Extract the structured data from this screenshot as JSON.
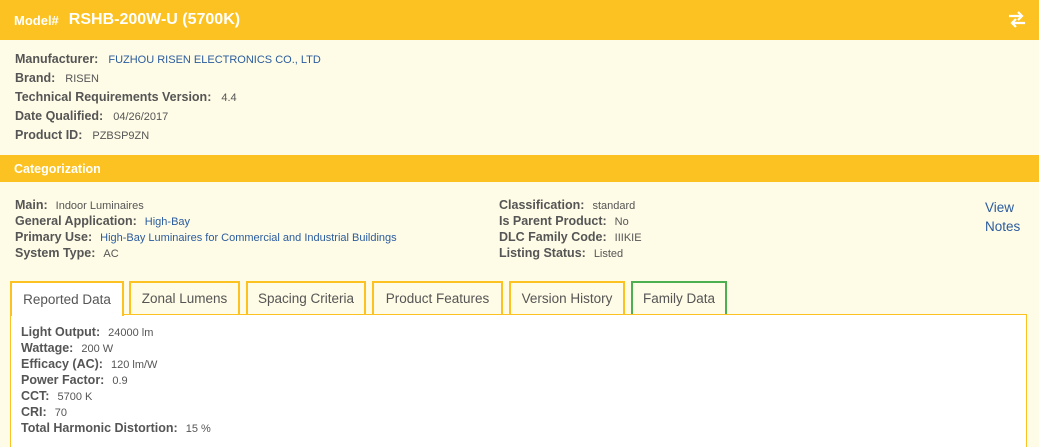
{
  "header": {
    "model_label": "Model#",
    "model_value": "RSHB-200W-U (5700K)",
    "swap_icon": "swap-arrows-icon"
  },
  "info": {
    "manufacturer_label": "Manufacturer:",
    "manufacturer_value": "FUZHOU RISEN ELECTRONICS CO., LTD",
    "brand_label": "Brand:",
    "brand_value": "RISEN",
    "tech_label": "Technical Requirements Version:",
    "tech_value": "4.4",
    "date_label": "Date Qualified:",
    "date_value": "04/26/2017",
    "product_id_label": "Product ID:",
    "product_id_value": "PZBSP9ZN"
  },
  "categorization": {
    "title": "Categorization",
    "main_label": "Main:",
    "main_value": "Indoor Luminaires",
    "general_label": "General Application:",
    "general_value": "High-Bay",
    "primary_label": "Primary Use:",
    "primary_value": "High-Bay Luminaires for Commercial and Industrial Buildings",
    "system_label": "System Type:",
    "system_value": "AC",
    "classification_label": "Classification:",
    "classification_value": "standard",
    "parent_label": "Is Parent Product:",
    "parent_value": "No",
    "family_code_label": "DLC Family Code:",
    "family_code_value": "IIIKIE",
    "listing_label": "Listing Status:",
    "listing_value": "Listed",
    "view_notes": "View Notes"
  },
  "tabs": [
    {
      "label": "Reported Data"
    },
    {
      "label": "Zonal Lumens"
    },
    {
      "label": "Spacing Criteria"
    },
    {
      "label": "Product Features"
    },
    {
      "label": "Version History"
    },
    {
      "label": "Family Data"
    }
  ],
  "reported": {
    "light_output_label": "Light Output:",
    "light_output_value": "24000 lm",
    "wattage_label": "Wattage:",
    "wattage_value": "200 W",
    "efficacy_label": "Efficacy (AC):",
    "efficacy_value": "120 lm/W",
    "power_factor_label": "Power Factor:",
    "power_factor_value": "0.9",
    "cct_label": "CCT:",
    "cct_value": "5700 K",
    "cri_label": "CRI:",
    "cri_value": "70",
    "thd_label": "Total Harmonic Distortion:",
    "thd_value": "15 %"
  }
}
